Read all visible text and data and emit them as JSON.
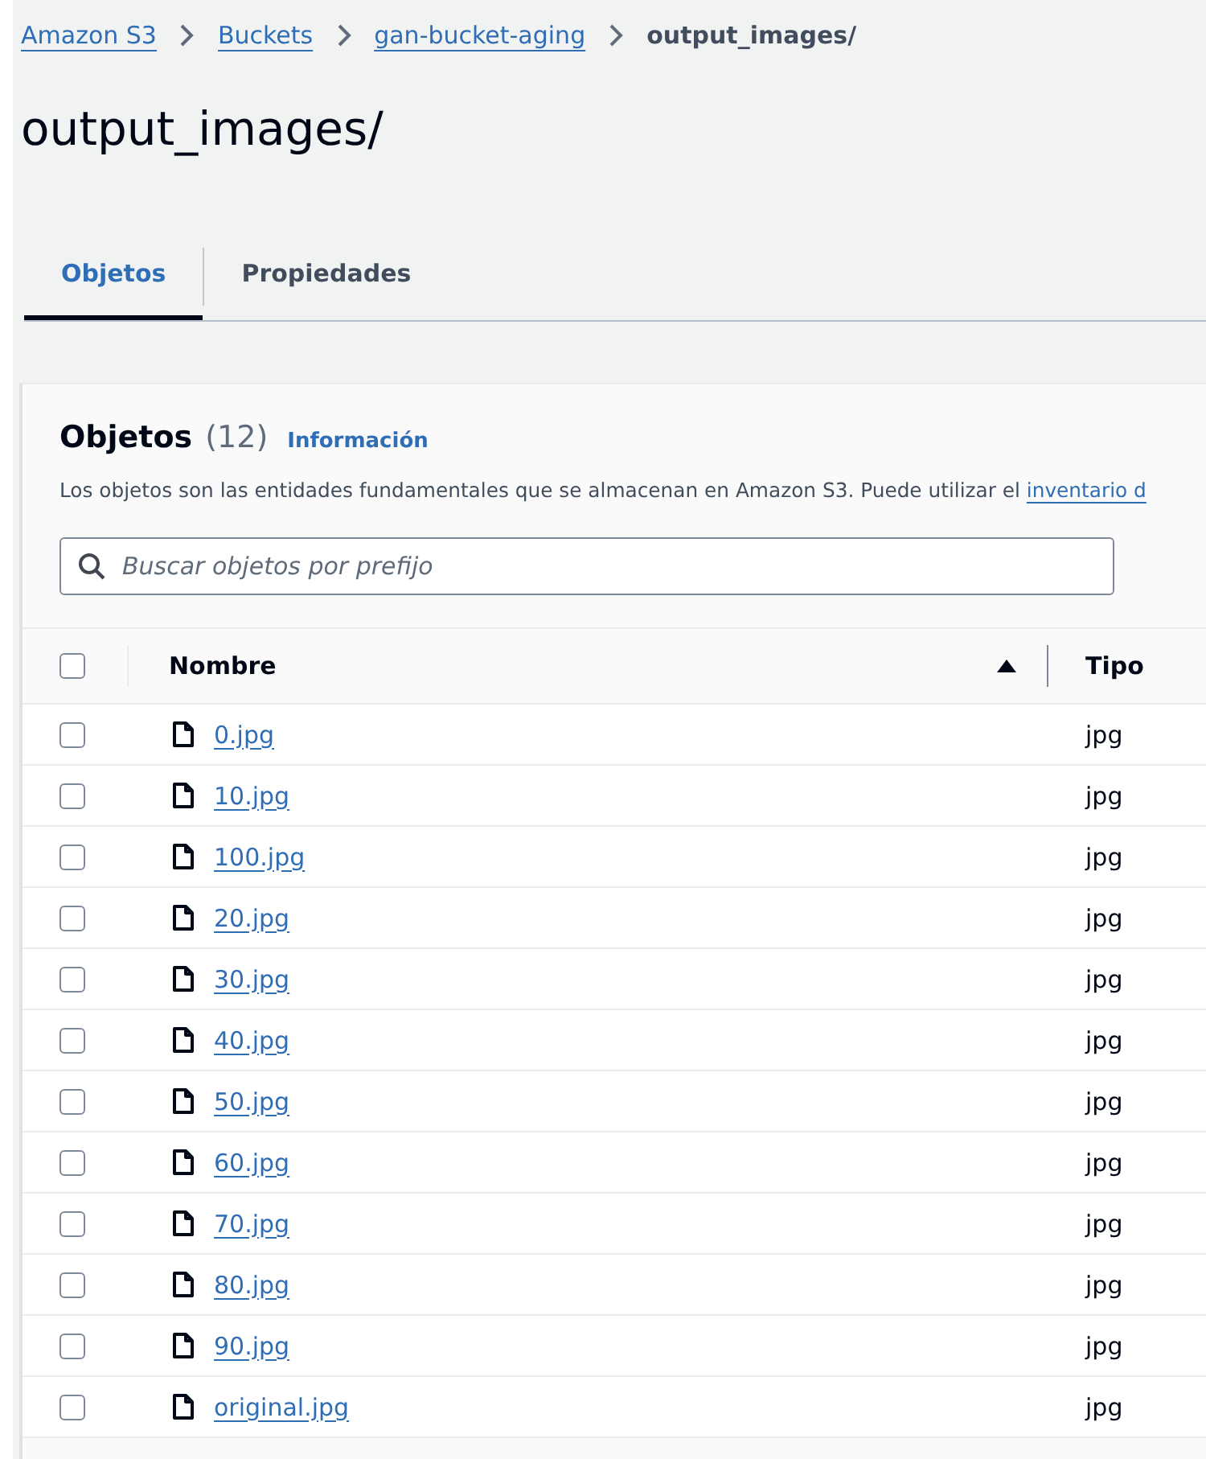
{
  "breadcrumbs": [
    {
      "label": "Amazon S3",
      "link": true
    },
    {
      "label": "Buckets",
      "link": true
    },
    {
      "label": "gan-bucket-aging",
      "link": true
    },
    {
      "label": "output_images/",
      "link": false
    }
  ],
  "title": "output_images/",
  "tabs": [
    {
      "label": "Objetos",
      "selected": true
    },
    {
      "label": "Propiedades",
      "selected": false
    }
  ],
  "objects_panel": {
    "heading": "Objetos",
    "count": "(12)",
    "info_link": "Información",
    "description": "Los objetos son las entidades fundamentales que se almacenan en Amazon S3. Puede utilizar el ",
    "description_link": "inventario d",
    "search": {
      "placeholder": "Buscar objetos por prefijo"
    },
    "table": {
      "select_all_checked": false,
      "columns": [
        {
          "label": "Nombre",
          "sorted_ascending": true
        },
        {
          "label": "Tipo"
        }
      ],
      "rows": [
        {
          "name": "0.jpg",
          "type": "jpg",
          "checked": false
        },
        {
          "name": "10.jpg",
          "type": "jpg",
          "checked": false
        },
        {
          "name": "100.jpg",
          "type": "jpg",
          "checked": false
        },
        {
          "name": "20.jpg",
          "type": "jpg",
          "checked": false
        },
        {
          "name": "30.jpg",
          "type": "jpg",
          "checked": false
        },
        {
          "name": "40.jpg",
          "type": "jpg",
          "checked": false
        },
        {
          "name": "50.jpg",
          "type": "jpg",
          "checked": false
        },
        {
          "name": "60.jpg",
          "type": "jpg",
          "checked": false
        },
        {
          "name": "70.jpg",
          "type": "jpg",
          "checked": false
        },
        {
          "name": "80.jpg",
          "type": "jpg",
          "checked": false
        },
        {
          "name": "90.jpg",
          "type": "jpg",
          "checked": false
        },
        {
          "name": "original.jpg",
          "type": "jpg",
          "checked": false
        }
      ]
    }
  }
}
